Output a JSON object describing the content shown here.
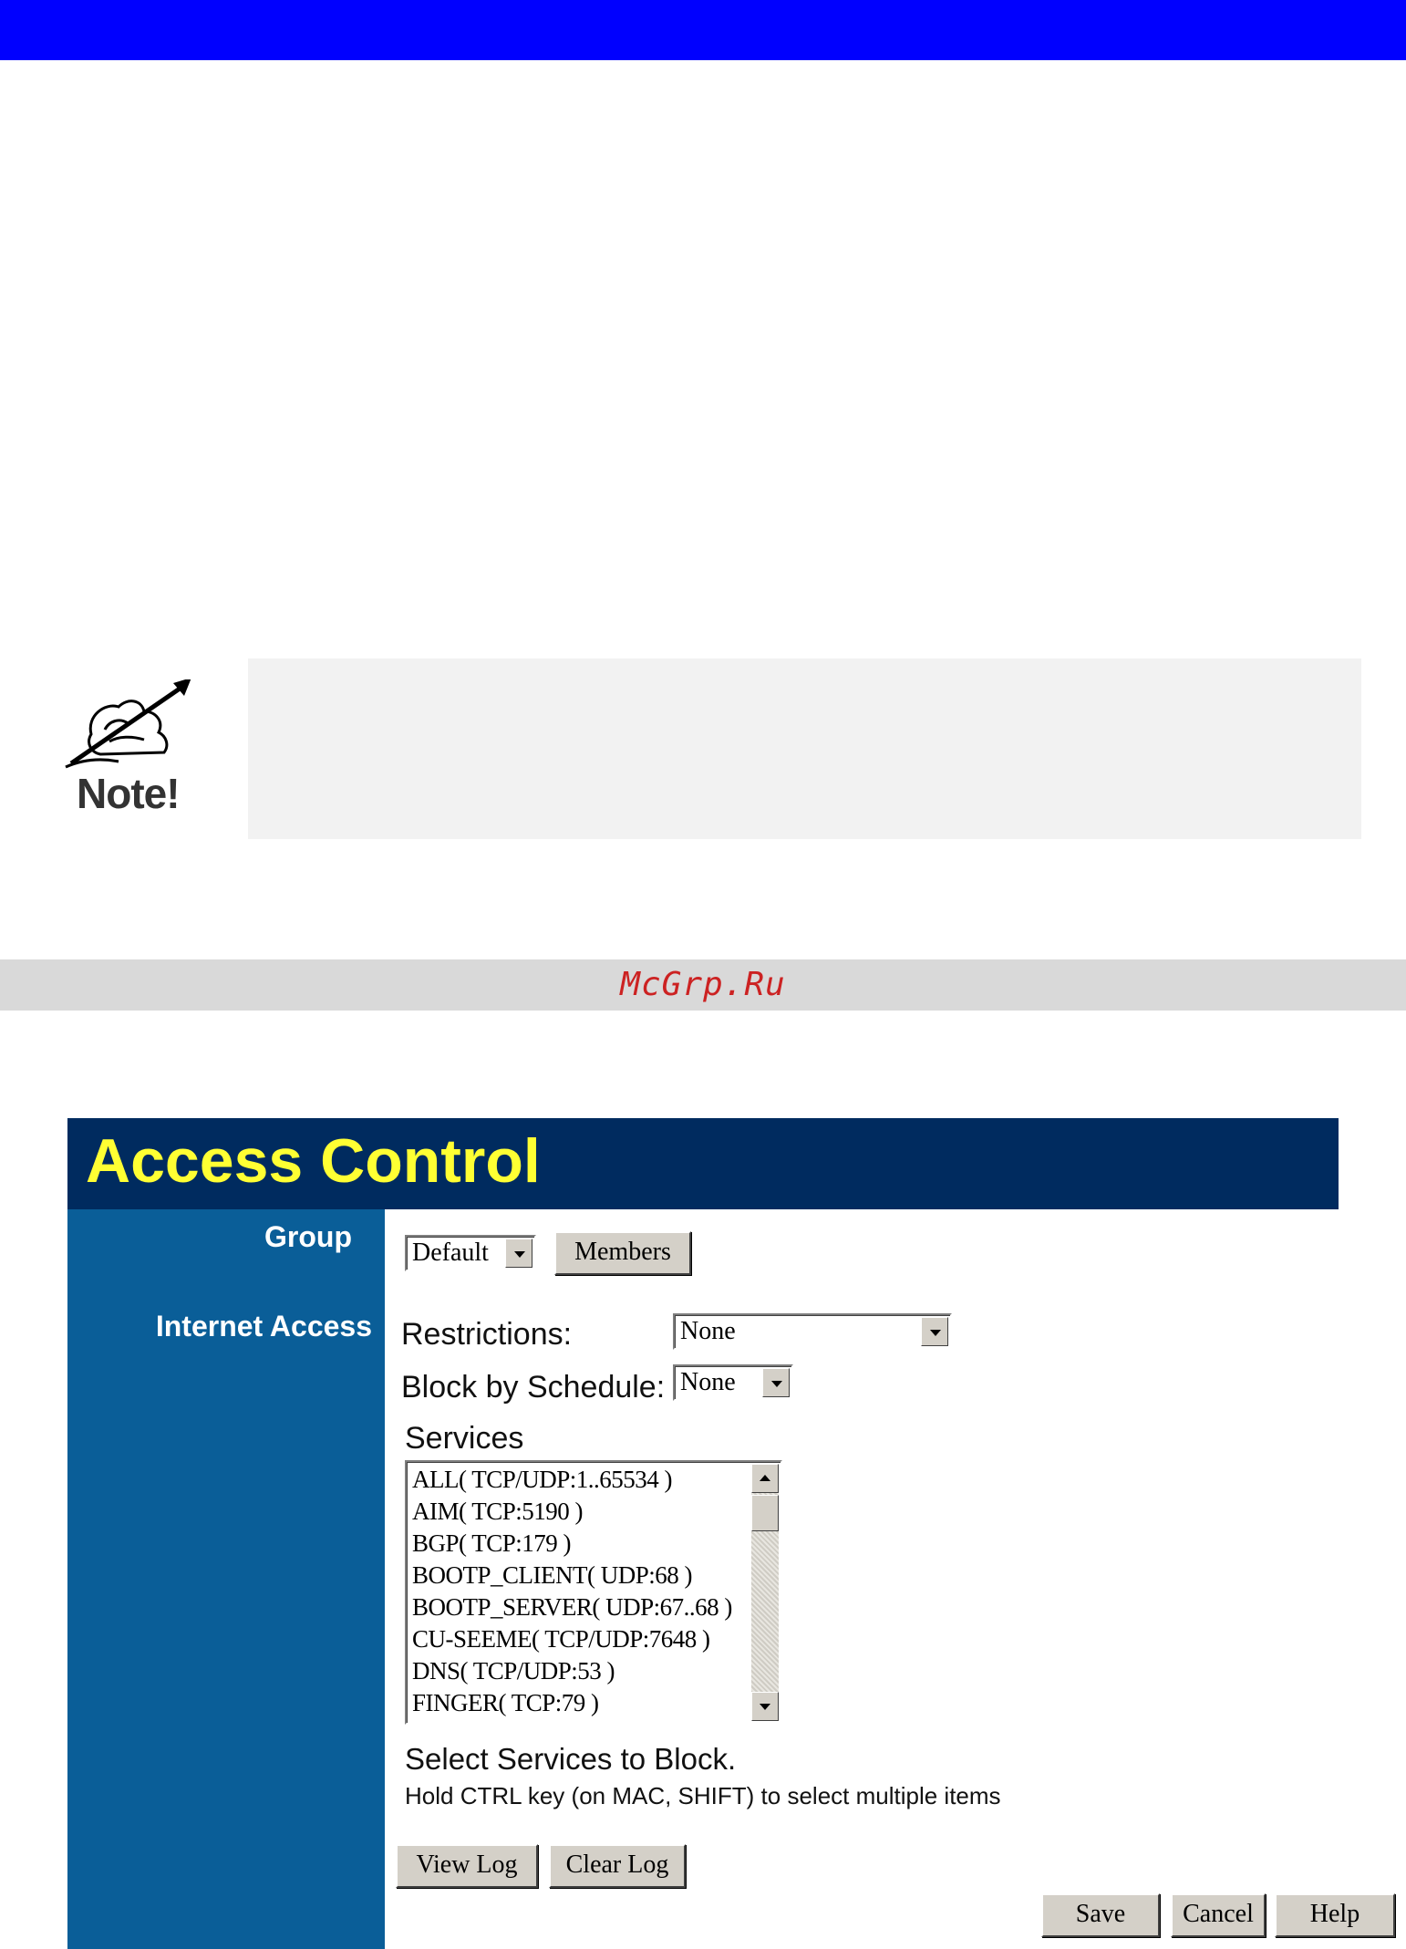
{
  "note": {
    "label": "Note!"
  },
  "watermark": {
    "text": "McGrp.Ru"
  },
  "panel": {
    "title": "Access Control",
    "sidebar": {
      "group_label": "Group",
      "internet_access_label": "Internet Access"
    },
    "group": {
      "selected": "Default",
      "members_button": "Members"
    },
    "restrictions": {
      "label": "Restrictions:",
      "selected": "None"
    },
    "schedule": {
      "label": "Block by Schedule:",
      "selected": "None"
    },
    "services": {
      "label": "Services",
      "items": [
        "ALL( TCP/UDP:1..65534 )",
        "AIM( TCP:5190 )",
        "BGP( TCP:179 )",
        "BOOTP_CLIENT( UDP:68 )",
        "BOOTP_SERVER( UDP:67..68 )",
        "CU-SEEME( TCP/UDP:7648 )",
        "DNS( TCP/UDP:53 )",
        "FINGER( TCP:79 )"
      ],
      "hint_title": "Select Services to Block.",
      "hint_text": "Hold CTRL key (on MAC, SHIFT) to select multiple items"
    },
    "buttons": {
      "view_log": "View Log",
      "clear_log": "Clear Log",
      "save": "Save",
      "cancel": "Cancel",
      "help": "Help"
    }
  }
}
